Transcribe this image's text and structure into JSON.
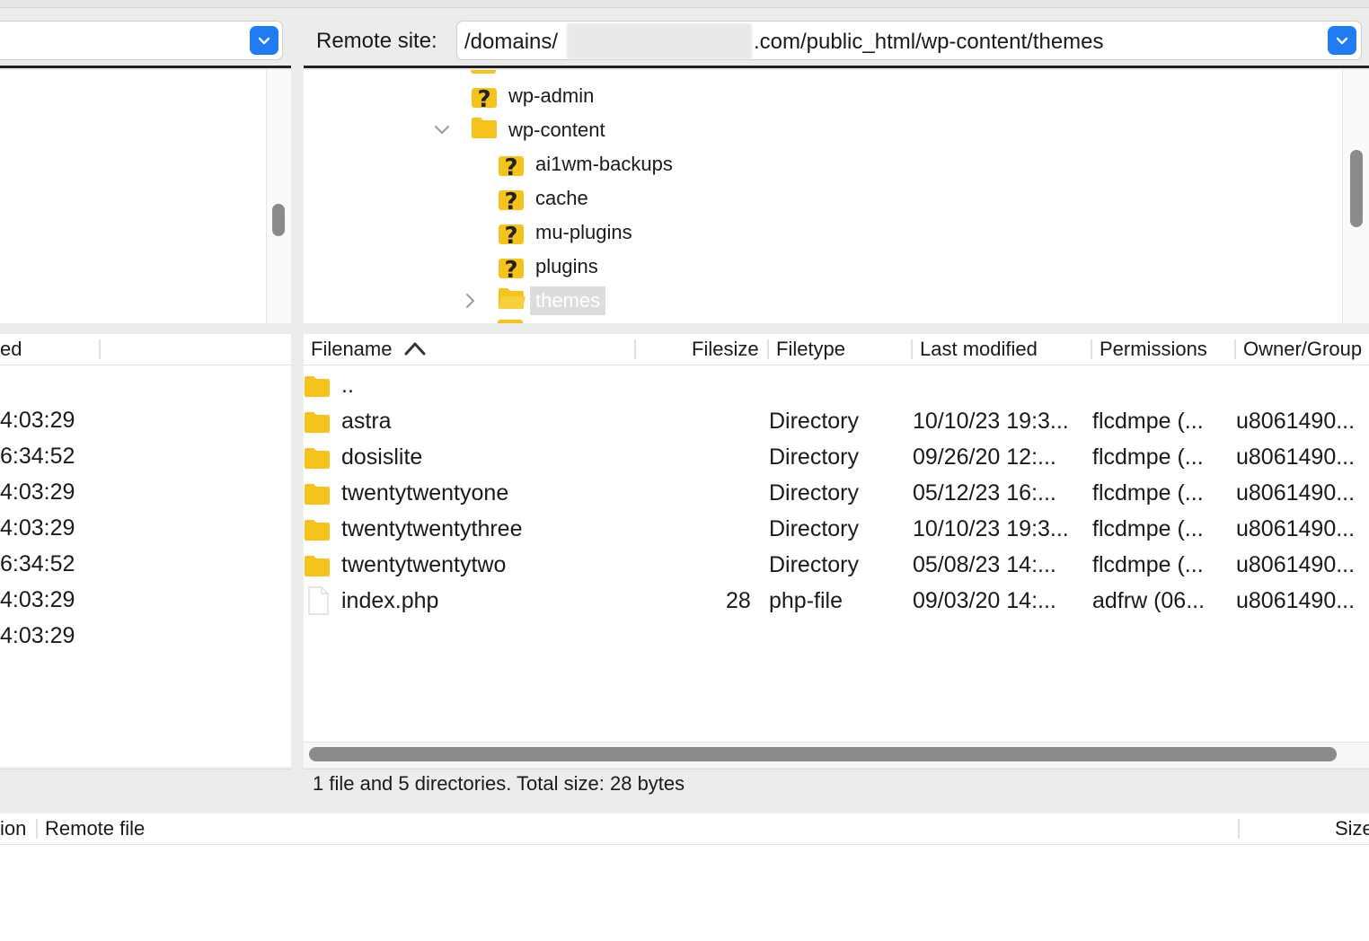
{
  "remote": {
    "label": "Remote site:",
    "path_prefix": "/domains/",
    "path_suffix": ".com/public_html/wp-content/themes"
  },
  "tree": {
    "items": [
      {
        "label": "wp-admin",
        "icon": "question-folder-icon"
      },
      {
        "label": "wp-content",
        "icon": "folder-icon",
        "expanded": true
      },
      {
        "label": "ai1wm-backups",
        "icon": "question-folder-icon"
      },
      {
        "label": "cache",
        "icon": "question-folder-icon"
      },
      {
        "label": "mu-plugins",
        "icon": "question-folder-icon"
      },
      {
        "label": "plugins",
        "icon": "question-folder-icon"
      },
      {
        "label": "themes",
        "icon": "folder-icon",
        "selected": true
      }
    ]
  },
  "local_list": {
    "header_partial": "ed",
    "times": [
      "4:03:29",
      "6:34:52",
      "4:03:29",
      "4:03:29",
      "6:34:52",
      "4:03:29",
      "4:03:29"
    ]
  },
  "file_list": {
    "columns": {
      "filename": "Filename",
      "filesize": "Filesize",
      "filetype": "Filetype",
      "last_modified": "Last modified",
      "permissions": "Permissions",
      "owner_group": "Owner/Group"
    },
    "rows": [
      {
        "name": "..",
        "size": "",
        "type": "",
        "modified": "",
        "perms": "",
        "owner": "",
        "icon": "folder-icon"
      },
      {
        "name": "astra",
        "size": "",
        "type": "Directory",
        "modified": "10/10/23 19:3...",
        "perms": "flcdmpe (...",
        "owner": "u8061490...",
        "icon": "folder-icon"
      },
      {
        "name": "dosislite",
        "size": "",
        "type": "Directory",
        "modified": "09/26/20 12:...",
        "perms": "flcdmpe (...",
        "owner": "u8061490...",
        "icon": "folder-icon"
      },
      {
        "name": "twentytwentyone",
        "size": "",
        "type": "Directory",
        "modified": "05/12/23 16:...",
        "perms": "flcdmpe (...",
        "owner": "u8061490...",
        "icon": "folder-icon"
      },
      {
        "name": "twentytwentythree",
        "size": "",
        "type": "Directory",
        "modified": "10/10/23 19:3...",
        "perms": "flcdmpe (...",
        "owner": "u8061490...",
        "icon": "folder-icon"
      },
      {
        "name": "twentytwentytwo",
        "size": "",
        "type": "Directory",
        "modified": "05/08/23 14:...",
        "perms": "flcdmpe (...",
        "owner": "u8061490...",
        "icon": "folder-icon"
      },
      {
        "name": "index.php",
        "size": "28",
        "type": "php-file",
        "modified": "09/03/20 14:...",
        "perms": "adfrw (06...",
        "owner": "u8061490...",
        "icon": "file-icon"
      }
    ],
    "status": "1 file and 5 directories. Total size: 28 bytes"
  },
  "queue": {
    "col_partial": "ion",
    "remote_file": "Remote file",
    "size": "Size"
  },
  "colors": {
    "accent": "#1f7cf6",
    "folder": "#f6c21c",
    "selection": "#dcdcdc"
  }
}
